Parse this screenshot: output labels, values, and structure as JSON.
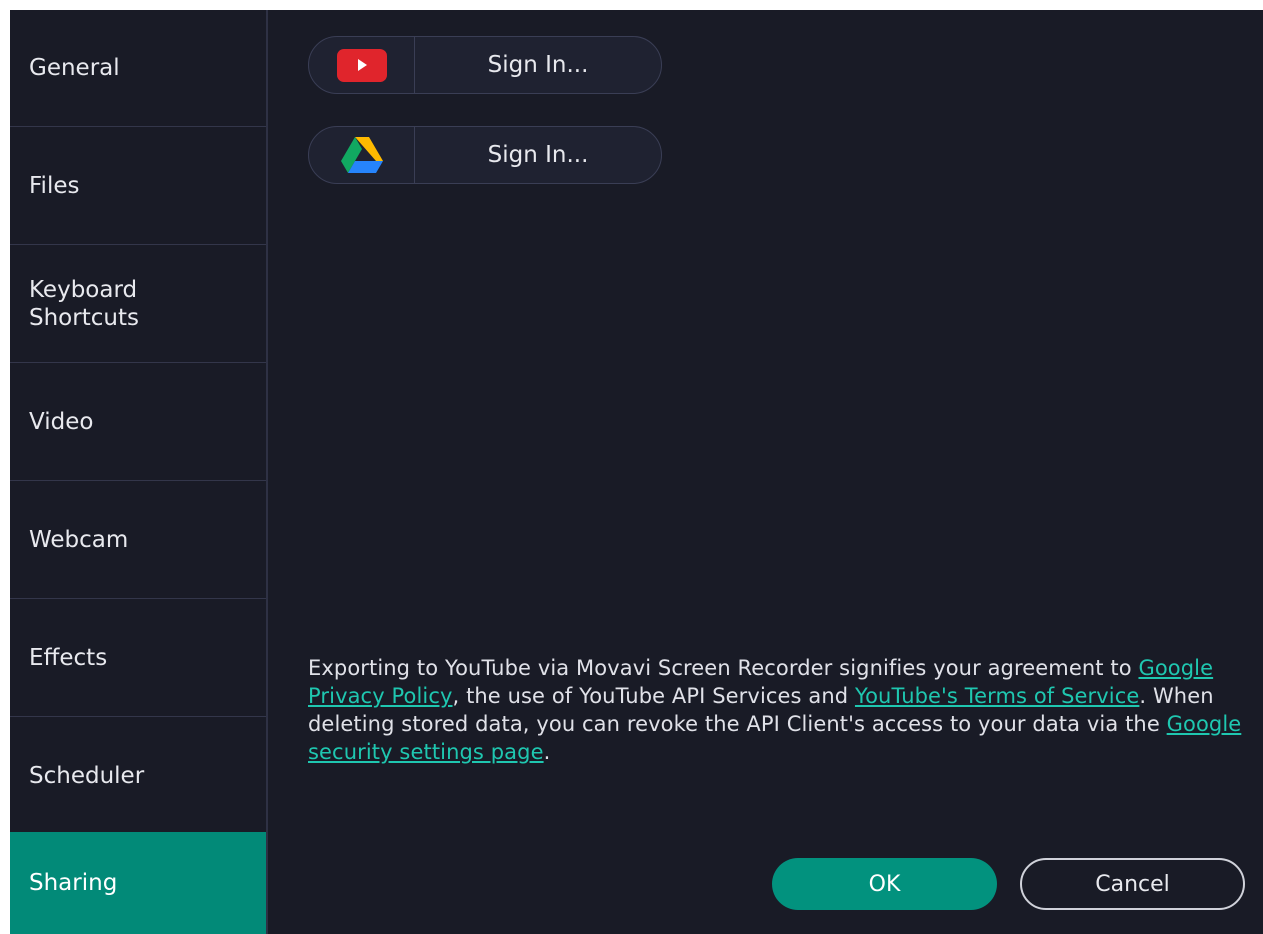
{
  "sidebar": {
    "items": [
      {
        "label": "General"
      },
      {
        "label": "Files"
      },
      {
        "label": "Keyboard\nShortcuts"
      },
      {
        "label": "Video"
      },
      {
        "label": "Webcam"
      },
      {
        "label": "Effects"
      },
      {
        "label": "Scheduler"
      },
      {
        "label": "Sharing",
        "active": true
      }
    ]
  },
  "sharing": {
    "youtube": {
      "icon": "youtube-icon",
      "label": "Sign In..."
    },
    "drive": {
      "icon": "google-drive-icon",
      "label": "Sign In..."
    },
    "notice": {
      "part1": "Exporting to YouTube via Movavi Screen Recorder signifies your agreement to ",
      "link1": "Google Privacy Policy",
      "part2": ", the use of YouTube API Services and ",
      "link2": "YouTube's Terms of Service",
      "part3": ". When deleting stored data, you can revoke the API Client's access to your data via the ",
      "link3": "Google security settings page",
      "part4": "."
    }
  },
  "footer": {
    "ok_label": "OK",
    "cancel_label": "Cancel"
  },
  "colors": {
    "accent": "#028a78",
    "background": "#191b26",
    "link": "#1fc7b0",
    "youtube_red": "#e0252c"
  }
}
